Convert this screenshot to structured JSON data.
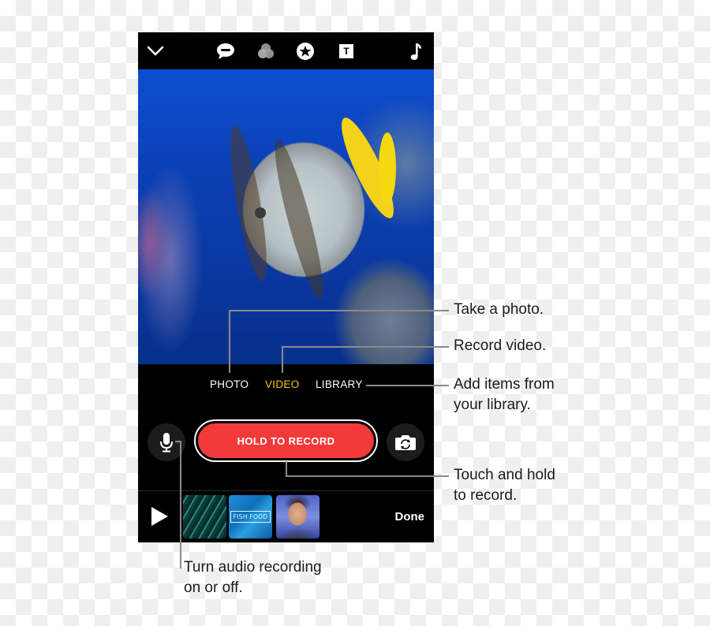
{
  "topbar": {
    "icons": [
      {
        "name": "chevron-down-icon"
      },
      {
        "name": "speech-bubble-icon"
      },
      {
        "name": "filters-icon"
      },
      {
        "name": "star-sticker-icon"
      },
      {
        "name": "text-icon",
        "glyph": "T"
      },
      {
        "name": "music-note-icon"
      }
    ]
  },
  "camera": {
    "modes": [
      {
        "label": "PHOTO",
        "selected": false
      },
      {
        "label": "VIDEO",
        "selected": true
      },
      {
        "label": "LIBRARY",
        "selected": false
      }
    ],
    "record_label": "HOLD TO RECORD",
    "accent_color": "#f5c518",
    "record_color": "#f23a3a"
  },
  "bottombar": {
    "thumbnails": [
      {
        "name": "fish-school-thumbnail"
      },
      {
        "name": "fish-food-title-thumbnail",
        "text": "FISH FOOD"
      },
      {
        "name": "selfie-thumbnail"
      }
    ],
    "done_label": "Done"
  },
  "callouts": {
    "photo": "Take a photo.",
    "video": "Record video.",
    "library_line1": "Add items from",
    "library_line2": "your library.",
    "record_line1": "Touch and hold",
    "record_line2": "to record.",
    "mic_line1": "Turn audio recording",
    "mic_line2": "on or off."
  }
}
